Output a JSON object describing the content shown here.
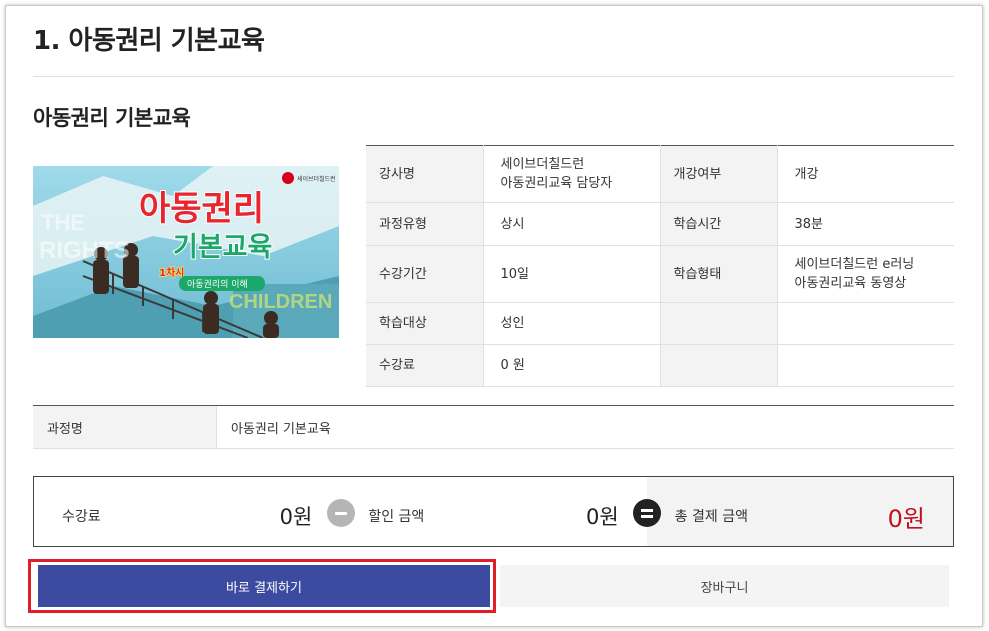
{
  "page": {
    "title": "1. 아동권리 기본교육",
    "subtitle": "아동권리 기본교육"
  },
  "thumbnail": {
    "logo_text": "세이브더칠드런",
    "headline_1": "아동권리",
    "headline_2": "기본교육",
    "chapter_badge": "1차시",
    "chapter_caption": "아동권리의 이해",
    "bg_text_1": "THE",
    "bg_text_2": "RIGHTS",
    "bg_text_3": "CHILDREN"
  },
  "info": {
    "instructor_label": "강사명",
    "instructor_line1": "세이브더칠드런",
    "instructor_line2": "아동권리교육 담당자",
    "open_label": "개강여부",
    "open_value": "개강",
    "type_label": "과정유형",
    "type_value": "상시",
    "time_label": "학습시간",
    "time_value": "38분",
    "period_label": "수강기간",
    "period_value": "10일",
    "format_label": "학습형태",
    "format_line1": "세이브더칠드런 e러닝",
    "format_line2": "아동권리교육 동영상",
    "target_label": "학습대상",
    "target_value": "성인",
    "fee_label": "수강료",
    "fee_value": "0 원"
  },
  "course": {
    "label": "과정명",
    "value": "아동권리 기본교육"
  },
  "price": {
    "fee_label": "수강료",
    "fee_value": "0원",
    "discount_label": "할인 금액",
    "discount_value": "0원",
    "total_label": "총 결제 금액",
    "total_value": "0원",
    "total_color": "#c1111b"
  },
  "buttons": {
    "buy_label": "바로 결제하기",
    "cart_label": "장바구니",
    "buy_color": "#3c4aa0",
    "highlight_color": "#e01e26"
  }
}
